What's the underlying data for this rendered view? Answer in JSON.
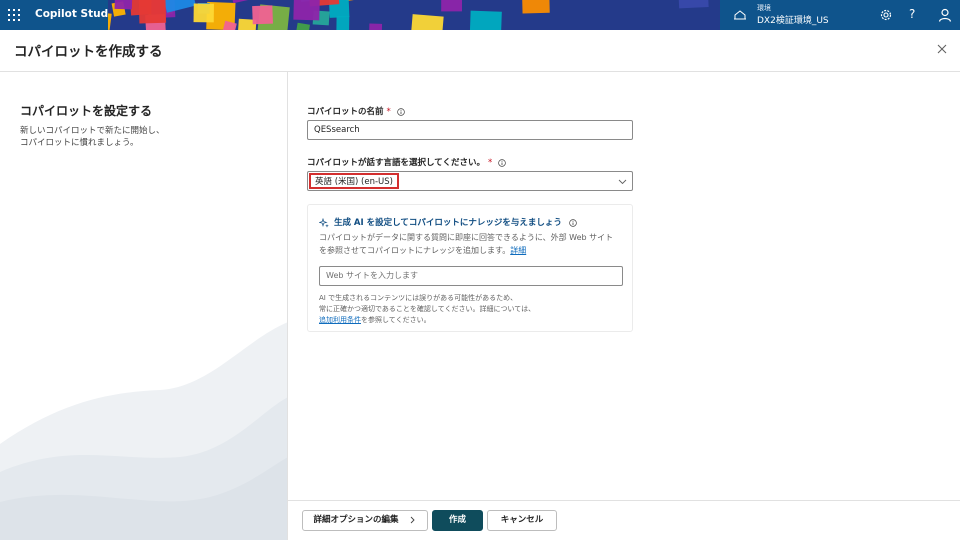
{
  "topbar": {
    "app_title": "Copilot Studio",
    "environment_label": "環境",
    "environment_name": "DX2検証環境_US",
    "icons": [
      "app-launcher-icon",
      "environment-icon",
      "settings-icon",
      "help-icon",
      "account-icon"
    ],
    "help_glyph": "?",
    "bar_color": "#0f548c"
  },
  "panel": {
    "title": "コパイロットを作成する",
    "close_icon": "close-icon"
  },
  "left": {
    "title": "コパイロットを設定する",
    "description": "新しいコパイロットで新たに開始し、\nコパイロットに慣れましょう。"
  },
  "form": {
    "name_label": "コパイロットの名前",
    "name_required": "*",
    "name_value": "QESsearch",
    "language_label": "コパイロットが話す言語を選択してください。",
    "language_required": "*",
    "language_value": "英語 (米国) (en-US)"
  },
  "knowledge": {
    "title": "生成 AI を設定してコパイロットにナレッジを与えましょう",
    "desc_text": "コパイロットがデータに関する質問に即座に回答できるように、外部 Web サイトを参照させてコパイロットにナレッジを追加します。",
    "desc_link": "詳細",
    "web_placeholder": "Web サイトを入力します",
    "disclaimer_line1": "AI で生成されるコンテンツには誤りがある可能性があるため、",
    "disclaimer_line2": "常に正確かつ適切であることを確認してください。詳細については、",
    "disclaimer_link": "追加利用条件",
    "disclaimer_tail": "を参照してください。"
  },
  "footer": {
    "advanced_label": "詳細オプションの編集",
    "create_label": "作成",
    "cancel_label": "キャンセル"
  },
  "colors": {
    "primary": "#0f4c5c",
    "link": "#0f6cbd",
    "highlight": "#d32f2f"
  }
}
